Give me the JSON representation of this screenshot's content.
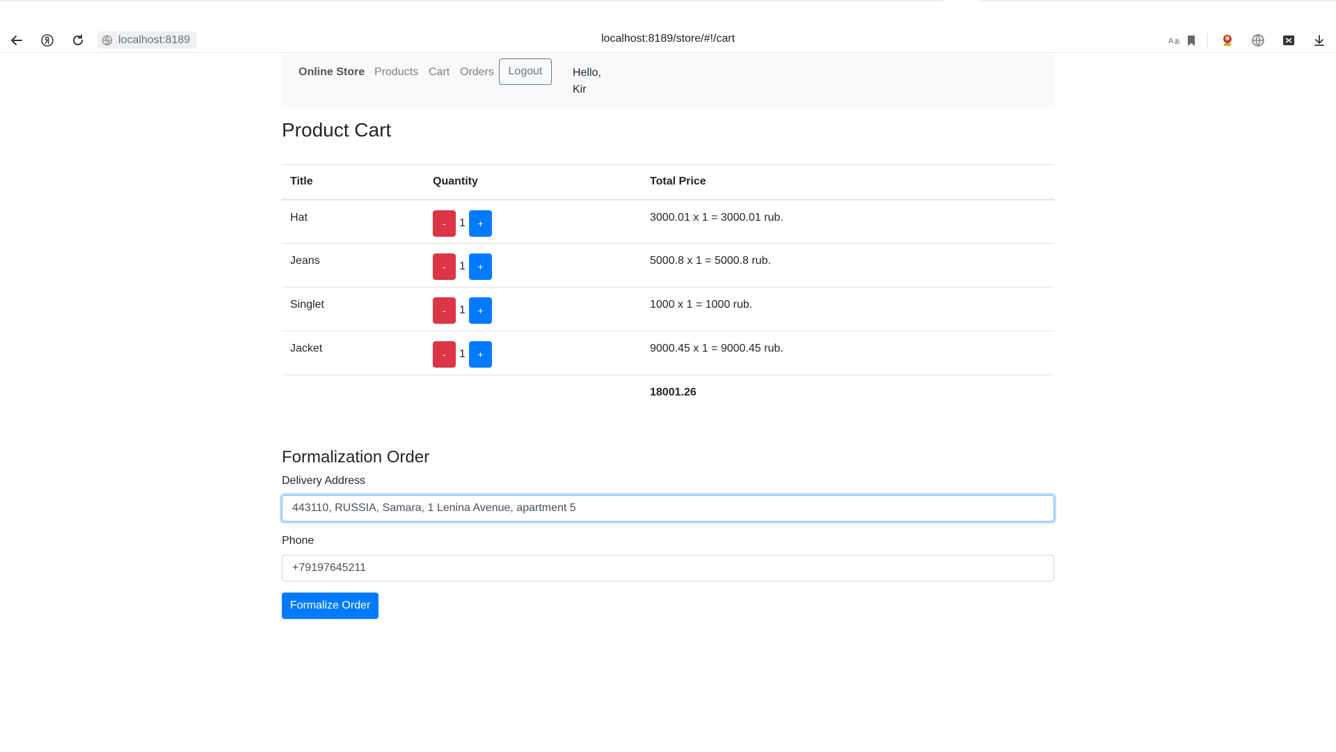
{
  "browser": {
    "site_chip": "localhost:8189",
    "url": "localhost:8189/store/#!/cart"
  },
  "navbar": {
    "brand": "Online Store",
    "links": [
      "Products",
      "Cart",
      "Orders"
    ],
    "logout_label": "Logout",
    "greeting_line1": "Hello,",
    "greeting_line2": "Kir"
  },
  "cart": {
    "title": "Product Cart",
    "headers": [
      "Title",
      "Quantity",
      "Total Price"
    ],
    "rows": [
      {
        "title": "Hat",
        "minus": "-",
        "qty": "1",
        "plus": "+",
        "total": "3000.01 x 1 = 3000.01 rub."
      },
      {
        "title": "Jeans",
        "minus": "-",
        "qty": "1",
        "plus": "+",
        "total": "5000.8 x 1 = 5000.8 rub."
      },
      {
        "title": "Singlet",
        "minus": "-",
        "qty": "1",
        "plus": "+",
        "total": "1000 x 1 = 1000 rub."
      },
      {
        "title": "Jacket",
        "minus": "-",
        "qty": "1",
        "plus": "+",
        "total": "9000.45 x 1 = 9000.45 rub."
      }
    ],
    "grand_total": "18001.26"
  },
  "order_form": {
    "title": "Formalization Order",
    "address_label": "Delivery Address",
    "address_value": "443110, RUSSIA, Samara, 1 Lenina Avenue, apartment 5",
    "phone_label": "Phone",
    "phone_value": "+79197645211",
    "submit_label": "Formalize Order"
  },
  "colors": {
    "primary": "#007bff",
    "danger": "#dc3545",
    "navbar_bg": "#f8f9fa"
  }
}
